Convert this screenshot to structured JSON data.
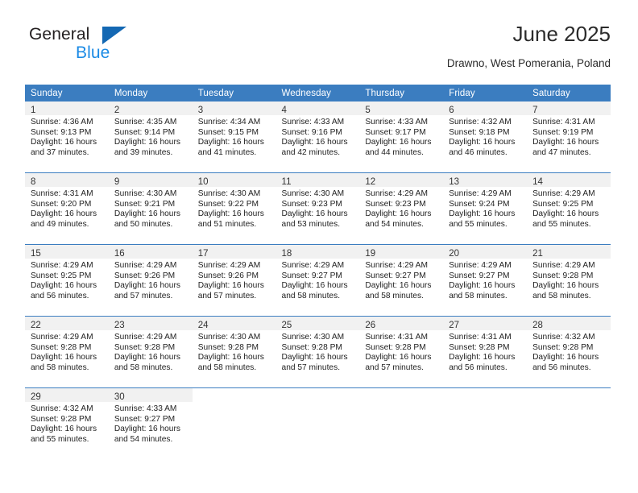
{
  "logo": {
    "word1": "General",
    "word2": "Blue",
    "triangle_color": "#1468b3",
    "blue_color": "#1a8ae5"
  },
  "header": {
    "title": "June 2025",
    "subtitle": "Drawno, West Pomerania, Poland"
  },
  "calendar": {
    "header_bg": "#3b7dc0",
    "daynum_band_bg": "#f1f1f1",
    "weekday_headers": [
      "Sunday",
      "Monday",
      "Tuesday",
      "Wednesday",
      "Thursday",
      "Friday",
      "Saturday"
    ],
    "weeks": [
      [
        {
          "day": "1",
          "sunrise": "Sunrise: 4:36 AM",
          "sunset": "Sunset: 9:13 PM",
          "daylight_line1": "Daylight: 16 hours",
          "daylight_line2": "and 37 minutes."
        },
        {
          "day": "2",
          "sunrise": "Sunrise: 4:35 AM",
          "sunset": "Sunset: 9:14 PM",
          "daylight_line1": "Daylight: 16 hours",
          "daylight_line2": "and 39 minutes."
        },
        {
          "day": "3",
          "sunrise": "Sunrise: 4:34 AM",
          "sunset": "Sunset: 9:15 PM",
          "daylight_line1": "Daylight: 16 hours",
          "daylight_line2": "and 41 minutes."
        },
        {
          "day": "4",
          "sunrise": "Sunrise: 4:33 AM",
          "sunset": "Sunset: 9:16 PM",
          "daylight_line1": "Daylight: 16 hours",
          "daylight_line2": "and 42 minutes."
        },
        {
          "day": "5",
          "sunrise": "Sunrise: 4:33 AM",
          "sunset": "Sunset: 9:17 PM",
          "daylight_line1": "Daylight: 16 hours",
          "daylight_line2": "and 44 minutes."
        },
        {
          "day": "6",
          "sunrise": "Sunrise: 4:32 AM",
          "sunset": "Sunset: 9:18 PM",
          "daylight_line1": "Daylight: 16 hours",
          "daylight_line2": "and 46 minutes."
        },
        {
          "day": "7",
          "sunrise": "Sunrise: 4:31 AM",
          "sunset": "Sunset: 9:19 PM",
          "daylight_line1": "Daylight: 16 hours",
          "daylight_line2": "and 47 minutes."
        }
      ],
      [
        {
          "day": "8",
          "sunrise": "Sunrise: 4:31 AM",
          "sunset": "Sunset: 9:20 PM",
          "daylight_line1": "Daylight: 16 hours",
          "daylight_line2": "and 49 minutes."
        },
        {
          "day": "9",
          "sunrise": "Sunrise: 4:30 AM",
          "sunset": "Sunset: 9:21 PM",
          "daylight_line1": "Daylight: 16 hours",
          "daylight_line2": "and 50 minutes."
        },
        {
          "day": "10",
          "sunrise": "Sunrise: 4:30 AM",
          "sunset": "Sunset: 9:22 PM",
          "daylight_line1": "Daylight: 16 hours",
          "daylight_line2": "and 51 minutes."
        },
        {
          "day": "11",
          "sunrise": "Sunrise: 4:30 AM",
          "sunset": "Sunset: 9:23 PM",
          "daylight_line1": "Daylight: 16 hours",
          "daylight_line2": "and 53 minutes."
        },
        {
          "day": "12",
          "sunrise": "Sunrise: 4:29 AM",
          "sunset": "Sunset: 9:23 PM",
          "daylight_line1": "Daylight: 16 hours",
          "daylight_line2": "and 54 minutes."
        },
        {
          "day": "13",
          "sunrise": "Sunrise: 4:29 AM",
          "sunset": "Sunset: 9:24 PM",
          "daylight_line1": "Daylight: 16 hours",
          "daylight_line2": "and 55 minutes."
        },
        {
          "day": "14",
          "sunrise": "Sunrise: 4:29 AM",
          "sunset": "Sunset: 9:25 PM",
          "daylight_line1": "Daylight: 16 hours",
          "daylight_line2": "and 55 minutes."
        }
      ],
      [
        {
          "day": "15",
          "sunrise": "Sunrise: 4:29 AM",
          "sunset": "Sunset: 9:25 PM",
          "daylight_line1": "Daylight: 16 hours",
          "daylight_line2": "and 56 minutes."
        },
        {
          "day": "16",
          "sunrise": "Sunrise: 4:29 AM",
          "sunset": "Sunset: 9:26 PM",
          "daylight_line1": "Daylight: 16 hours",
          "daylight_line2": "and 57 minutes."
        },
        {
          "day": "17",
          "sunrise": "Sunrise: 4:29 AM",
          "sunset": "Sunset: 9:26 PM",
          "daylight_line1": "Daylight: 16 hours",
          "daylight_line2": "and 57 minutes."
        },
        {
          "day": "18",
          "sunrise": "Sunrise: 4:29 AM",
          "sunset": "Sunset: 9:27 PM",
          "daylight_line1": "Daylight: 16 hours",
          "daylight_line2": "and 58 minutes."
        },
        {
          "day": "19",
          "sunrise": "Sunrise: 4:29 AM",
          "sunset": "Sunset: 9:27 PM",
          "daylight_line1": "Daylight: 16 hours",
          "daylight_line2": "and 58 minutes."
        },
        {
          "day": "20",
          "sunrise": "Sunrise: 4:29 AM",
          "sunset": "Sunset: 9:27 PM",
          "daylight_line1": "Daylight: 16 hours",
          "daylight_line2": "and 58 minutes."
        },
        {
          "day": "21",
          "sunrise": "Sunrise: 4:29 AM",
          "sunset": "Sunset: 9:28 PM",
          "daylight_line1": "Daylight: 16 hours",
          "daylight_line2": "and 58 minutes."
        }
      ],
      [
        {
          "day": "22",
          "sunrise": "Sunrise: 4:29 AM",
          "sunset": "Sunset: 9:28 PM",
          "daylight_line1": "Daylight: 16 hours",
          "daylight_line2": "and 58 minutes."
        },
        {
          "day": "23",
          "sunrise": "Sunrise: 4:29 AM",
          "sunset": "Sunset: 9:28 PM",
          "daylight_line1": "Daylight: 16 hours",
          "daylight_line2": "and 58 minutes."
        },
        {
          "day": "24",
          "sunrise": "Sunrise: 4:30 AM",
          "sunset": "Sunset: 9:28 PM",
          "daylight_line1": "Daylight: 16 hours",
          "daylight_line2": "and 58 minutes."
        },
        {
          "day": "25",
          "sunrise": "Sunrise: 4:30 AM",
          "sunset": "Sunset: 9:28 PM",
          "daylight_line1": "Daylight: 16 hours",
          "daylight_line2": "and 57 minutes."
        },
        {
          "day": "26",
          "sunrise": "Sunrise: 4:31 AM",
          "sunset": "Sunset: 9:28 PM",
          "daylight_line1": "Daylight: 16 hours",
          "daylight_line2": "and 57 minutes."
        },
        {
          "day": "27",
          "sunrise": "Sunrise: 4:31 AM",
          "sunset": "Sunset: 9:28 PM",
          "daylight_line1": "Daylight: 16 hours",
          "daylight_line2": "and 56 minutes."
        },
        {
          "day": "28",
          "sunrise": "Sunrise: 4:32 AM",
          "sunset": "Sunset: 9:28 PM",
          "daylight_line1": "Daylight: 16 hours",
          "daylight_line2": "and 56 minutes."
        }
      ],
      [
        {
          "day": "29",
          "sunrise": "Sunrise: 4:32 AM",
          "sunset": "Sunset: 9:28 PM",
          "daylight_line1": "Daylight: 16 hours",
          "daylight_line2": "and 55 minutes."
        },
        {
          "day": "30",
          "sunrise": "Sunrise: 4:33 AM",
          "sunset": "Sunset: 9:27 PM",
          "daylight_line1": "Daylight: 16 hours",
          "daylight_line2": "and 54 minutes."
        },
        {
          "day": "",
          "sunrise": "",
          "sunset": "",
          "daylight_line1": "",
          "daylight_line2": ""
        },
        {
          "day": "",
          "sunrise": "",
          "sunset": "",
          "daylight_line1": "",
          "daylight_line2": ""
        },
        {
          "day": "",
          "sunrise": "",
          "sunset": "",
          "daylight_line1": "",
          "daylight_line2": ""
        },
        {
          "day": "",
          "sunrise": "",
          "sunset": "",
          "daylight_line1": "",
          "daylight_line2": ""
        },
        {
          "day": "",
          "sunrise": "",
          "sunset": "",
          "daylight_line1": "",
          "daylight_line2": ""
        }
      ]
    ]
  }
}
